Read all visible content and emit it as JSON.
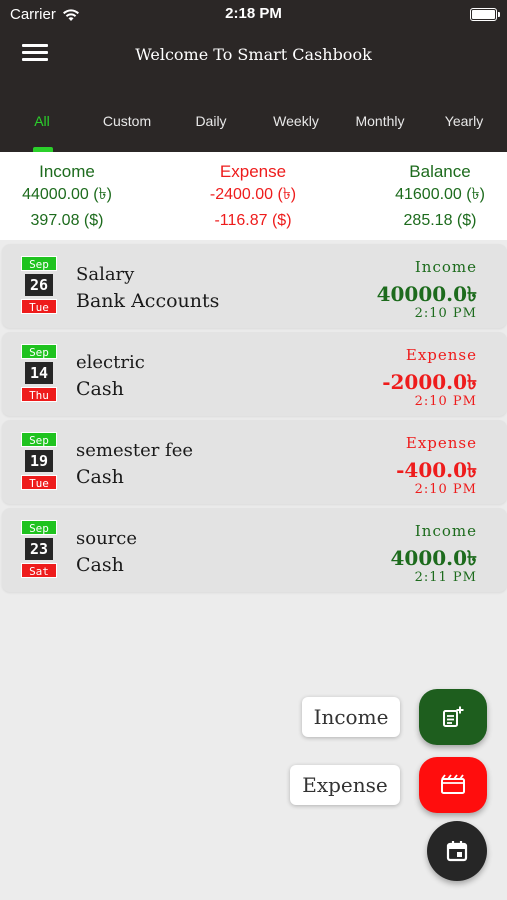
{
  "status_bar": {
    "carrier": "Carrier",
    "time": "2:18 PM"
  },
  "header": {
    "title": "Welcome To Smart Cashbook"
  },
  "tabs": [
    "All",
    "Custom",
    "Daily",
    "Weekly",
    "Monthly",
    "Yearly"
  ],
  "active_tab": "All",
  "summary": {
    "income": {
      "label": "Income",
      "bdt": "44000.00 (৳)",
      "usd": "397.08 ($)"
    },
    "expense": {
      "label": "Expense",
      "bdt": "-2400.00 (৳)",
      "usd": "-116.87 ($)"
    },
    "balance": {
      "label": "Balance",
      "bdt": "41600.00 (৳)",
      "usd": "285.18 ($)"
    }
  },
  "transactions": [
    {
      "month": "Sep",
      "day": "26",
      "weekday": "Tue",
      "title": "Salary",
      "account": "Bank Accounts",
      "type": "Income",
      "amount": "40000.0৳",
      "time": "2:10 PM"
    },
    {
      "month": "Sep",
      "day": "14",
      "weekday": "Thu",
      "title": "electric",
      "account": "Cash",
      "type": "Expense",
      "amount": "-2000.0৳",
      "time": "2:10 PM"
    },
    {
      "month": "Sep",
      "day": "19",
      "weekday": "Tue",
      "title": "semester fee",
      "account": "Cash",
      "type": "Expense",
      "amount": "-400.0৳",
      "time": "2:10 PM"
    },
    {
      "month": "Sep",
      "day": "23",
      "weekday": "Sat",
      "title": "source",
      "account": "Cash",
      "type": "Income",
      "amount": "4000.0৳",
      "time": "2:11 PM"
    }
  ],
  "fab_menu": {
    "income_label": "Income",
    "expense_label": "Expense"
  },
  "colors": {
    "header_bg": "#2b2726",
    "active_tab": "#2bd02b",
    "income": "#1d6b1d",
    "expense": "#ee1c1c",
    "fab_income": "#1e5e1e",
    "fab_expense": "#ff0d0d",
    "fab_main": "#262626"
  },
  "icons": {
    "menu": "hamburger-icon",
    "wifi": "wifi-icon",
    "battery": "battery-icon",
    "income_fab": "note-add-icon",
    "expense_fab": "receipt-icon",
    "main_fab": "calendar-icon"
  }
}
